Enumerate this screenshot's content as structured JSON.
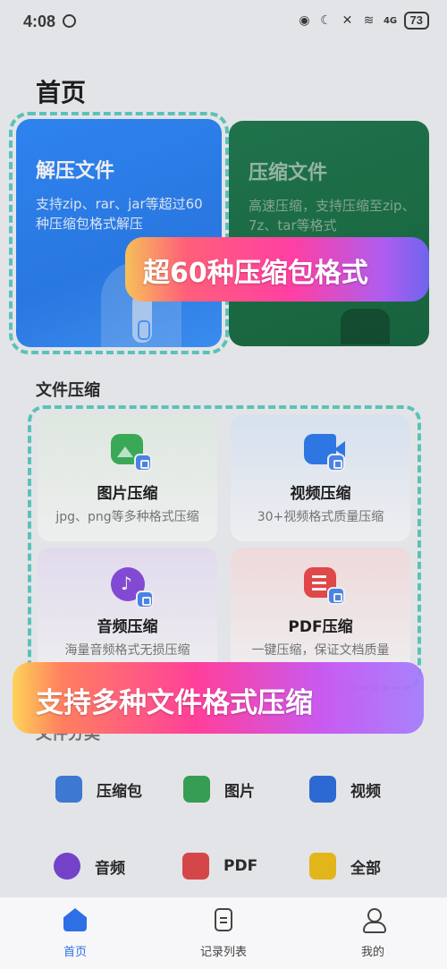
{
  "status_bar": {
    "time": "4:08",
    "battery": "73",
    "network": "4G"
  },
  "page_title": "首页",
  "hero": {
    "extract": {
      "title": "解压文件",
      "desc": "支持zip、rar、jar等超过60种压缩包格式解压"
    },
    "compress": {
      "title": "压缩文件",
      "desc": "高速压缩，支持压缩至zip、7z、tar等格式"
    }
  },
  "promos": {
    "top": "超60种压缩包格式",
    "bottom": "支持多种文件格式压缩"
  },
  "file_compress": {
    "section_title": "文件压缩",
    "tiles": [
      {
        "title": "图片压缩",
        "desc": "jpg、png等多种格式压缩",
        "icon": "image-icon"
      },
      {
        "title": "视频压缩",
        "desc": "30+视频格式质量压缩",
        "icon": "video-icon"
      },
      {
        "title": "音频压缩",
        "desc": "海量音频格式无损压缩",
        "icon": "audio-icon"
      },
      {
        "title": "PDF压缩",
        "desc": "一键压缩，保证文档质量",
        "icon": "pdf-icon"
      }
    ]
  },
  "categories": {
    "section_title": "文件分类",
    "items": [
      {
        "label": "压缩包",
        "icon": "zip-icon"
      },
      {
        "label": "图片",
        "icon": "image-icon"
      },
      {
        "label": "视频",
        "icon": "video-icon"
      },
      {
        "label": "音频",
        "icon": "audio-icon"
      },
      {
        "label": "PDF",
        "icon": "pdf-icon"
      },
      {
        "label": "全部",
        "icon": "folder-icon"
      }
    ]
  },
  "bottom_nav": [
    {
      "label": "首页",
      "icon": "home-icon",
      "active": true
    },
    {
      "label": "记录列表",
      "icon": "records-icon",
      "active": false
    },
    {
      "label": "我的",
      "icon": "profile-icon",
      "active": false
    }
  ],
  "colors": {
    "accent": "#2f6fe6",
    "extract_card": "#2f8bff",
    "compress_card": "#1f7a4e",
    "highlight_outline": "#5fd0c5"
  }
}
